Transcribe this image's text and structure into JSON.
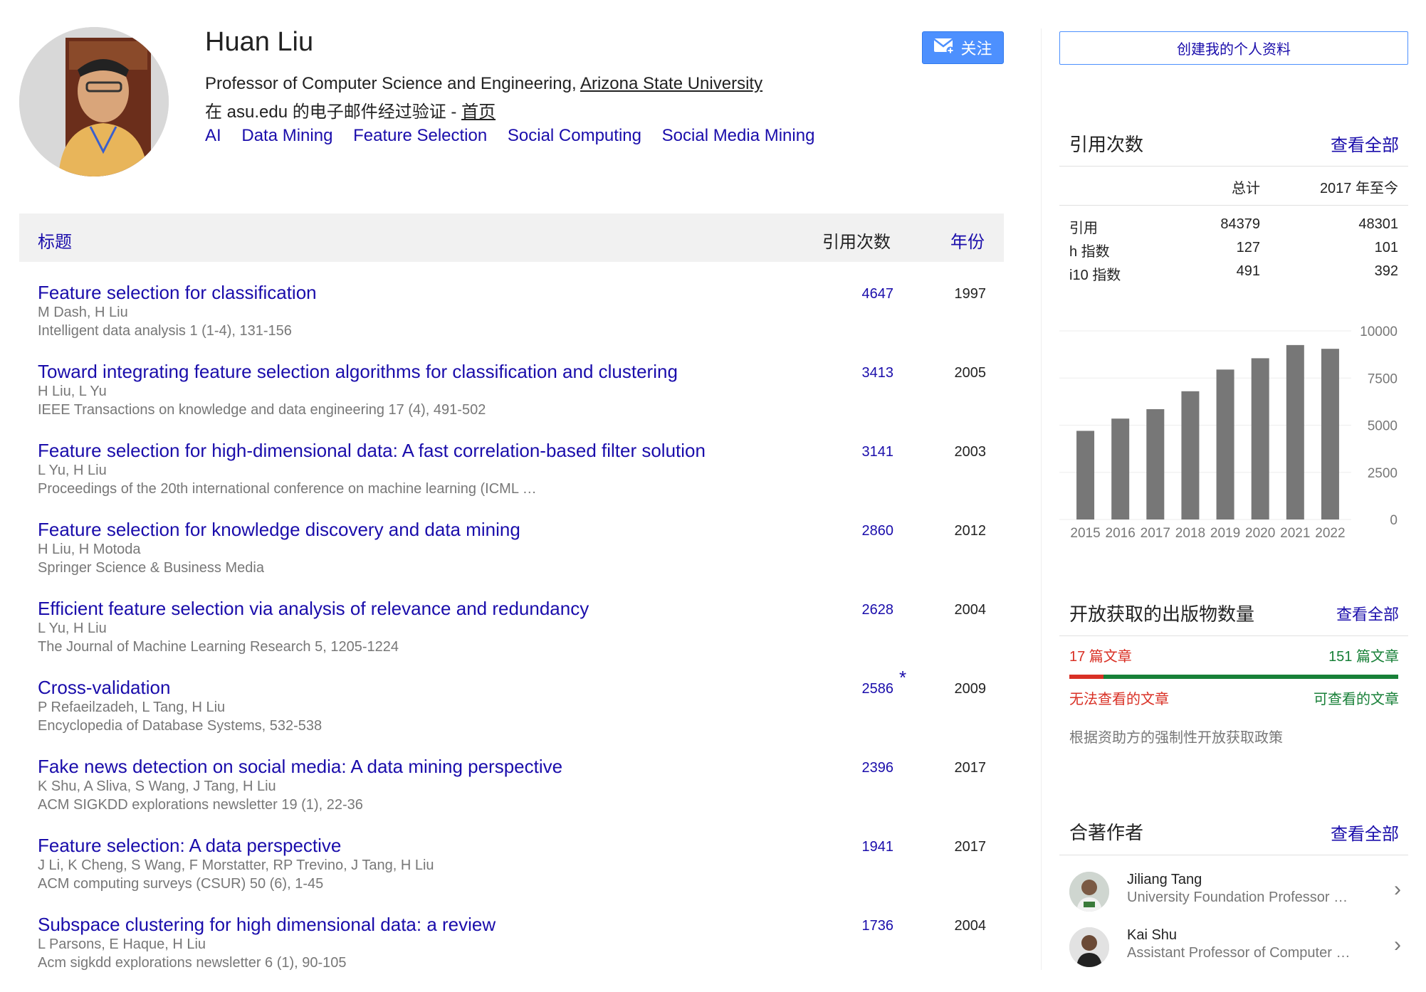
{
  "profile": {
    "name": "Huan Liu",
    "affiliation_prefix": "Professor of Computer Science and Engineering, ",
    "affiliation_link": "Arizona State University",
    "verified_text": "在 asu.edu 的电子邮件经过验证 - ",
    "homepage_label": "首页",
    "interests": [
      "AI",
      "Data Mining",
      "Feature Selection",
      "Social Computing",
      "Social Media Mining"
    ],
    "follow_label": "关注"
  },
  "table": {
    "header_title": "标题",
    "header_cites": "引用次数",
    "header_year": "年份",
    "rows": [
      {
        "title": "Feature selection for classification",
        "authors": "M Dash, H Liu",
        "venue": "Intelligent data analysis 1 (1-4), 131-156",
        "cites": "4647",
        "star": "",
        "year": "1997"
      },
      {
        "title": "Toward integrating feature selection algorithms for classification and clustering",
        "authors": "H Liu, L Yu",
        "venue": "IEEE Transactions on knowledge and data engineering 17 (4), 491-502",
        "cites": "3413",
        "star": "",
        "year": "2005"
      },
      {
        "title": "Feature selection for high-dimensional data: A fast correlation-based filter solution",
        "authors": "L Yu, H Liu",
        "venue": "Proceedings of the 20th international conference on machine learning (ICML …",
        "cites": "3141",
        "star": "",
        "year": "2003"
      },
      {
        "title": "Feature selection for knowledge discovery and data mining",
        "authors": "H Liu, H Motoda",
        "venue": "Springer Science & Business Media",
        "cites": "2860",
        "star": "",
        "year": "2012"
      },
      {
        "title": "Efficient feature selection via analysis of relevance and redundancy",
        "authors": "L Yu, H Liu",
        "venue": "The Journal of Machine Learning Research 5, 1205-1224",
        "cites": "2628",
        "star": "",
        "year": "2004"
      },
      {
        "title": "Cross-validation",
        "authors": "P Refaeilzadeh, L Tang, H Liu",
        "venue": "Encyclopedia of Database Systems, 532-538",
        "cites": "2586",
        "star": "*",
        "year": "2009"
      },
      {
        "title": "Fake news detection on social media: A data mining perspective",
        "authors": "K Shu, A Sliva, S Wang, J Tang, H Liu",
        "venue": "ACM SIGKDD explorations newsletter 19 (1), 22-36",
        "cites": "2396",
        "star": "",
        "year": "2017"
      },
      {
        "title": "Feature selection: A data perspective",
        "authors": "J Li, K Cheng, S Wang, F Morstatter, RP Trevino, J Tang, H Liu",
        "venue": "ACM computing surveys (CSUR) 50 (6), 1-45",
        "cites": "1941",
        "star": "",
        "year": "2017"
      },
      {
        "title": "Subspace clustering for high dimensional data: a review",
        "authors": "L Parsons, E Haque, H Liu",
        "venue": "Acm sigkdd explorations newsletter 6 (1), 90-105",
        "cites": "1736",
        "star": "",
        "year": "2004"
      }
    ]
  },
  "sidebar": {
    "create_profile_label": "创建我的个人资料",
    "citations": {
      "title": "引用次数",
      "view_all": "查看全部",
      "col_total": "总计",
      "col_since": "2017 年至今",
      "rows": [
        {
          "label": "引用",
          "total": "84379",
          "since": "48301"
        },
        {
          "label": "h 指数",
          "total": "127",
          "since": "101"
        },
        {
          "label": "i10 指数",
          "total": "491",
          "since": "392"
        }
      ]
    },
    "open_access": {
      "title": "开放获取的出版物数量",
      "view_all": "查看全部",
      "unavailable_count": "17 篇文章",
      "available_count": "151 篇文章",
      "unavailable_label": "无法查看的文章",
      "available_label": "可查看的文章",
      "mandates": "根据资助方的强制性开放获取政策",
      "color_unavailable": "#d93025",
      "color_available": "#188038"
    },
    "coauthors": {
      "title": "合著作者",
      "view_all": "查看全部",
      "items": [
        {
          "name": "Jiliang Tang",
          "affiliation": "University Foundation Professor …",
          "icon": "chevron-right-icon"
        },
        {
          "name": "Kai Shu",
          "affiliation": "Assistant Professor of Computer …",
          "icon": "chevron-right-icon"
        }
      ]
    }
  },
  "chart_data": {
    "type": "bar",
    "categories": [
      "2015",
      "2016",
      "2017",
      "2018",
      "2019",
      "2020",
      "2021",
      "2022"
    ],
    "values": [
      4700,
      5350,
      5850,
      6800,
      7950,
      8550,
      9250,
      9050
    ],
    "ylim": [
      0,
      10000
    ],
    "yticks": [
      "10000",
      "7500",
      "5000",
      "2500",
      "0"
    ],
    "bar_color": "#777777",
    "grid": true
  }
}
